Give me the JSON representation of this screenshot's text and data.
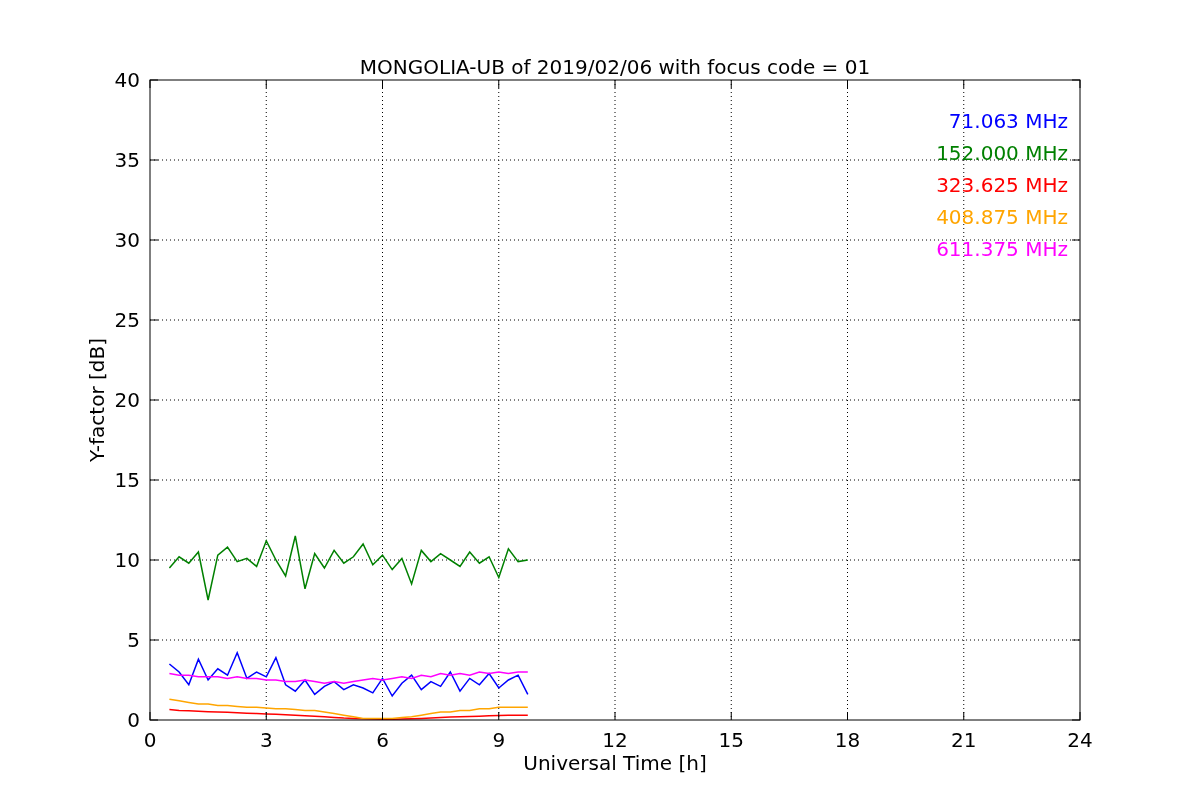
{
  "chart_data": {
    "type": "line",
    "title": "MONGOLIA-UB of 2019/02/06 with focus code = 01",
    "xlabel": "Universal Time [h]",
    "ylabel": "Y-factor [dB]",
    "x": [
      0.5,
      0.75,
      1,
      1.25,
      1.5,
      1.75,
      2,
      2.25,
      2.5,
      2.75,
      3,
      3.25,
      3.5,
      3.75,
      4,
      4.25,
      4.5,
      4.75,
      5,
      5.25,
      5.5,
      5.75,
      6,
      6.25,
      6.5,
      6.75,
      7,
      7.25,
      7.5,
      7.75,
      8,
      8.25,
      8.5,
      8.75,
      9,
      9.25,
      9.5,
      9.75
    ],
    "grid": true,
    "xlim": [
      0,
      24
    ],
    "ylim": [
      0,
      40
    ],
    "xticks": [
      0,
      3,
      6,
      9,
      12,
      15,
      18,
      21,
      24
    ],
    "yticks": [
      0,
      5,
      10,
      15,
      20,
      25,
      30,
      35,
      40
    ],
    "series": [
      {
        "name": "71.063 MHz",
        "color": "#0000ff",
        "values": [
          3.5,
          3.0,
          2.2,
          3.8,
          2.5,
          3.2,
          2.8,
          4.2,
          2.6,
          3.0,
          2.7,
          3.9,
          2.2,
          1.8,
          2.5,
          1.6,
          2.1,
          2.4,
          1.9,
          2.2,
          2.0,
          1.7,
          2.6,
          1.5,
          2.3,
          2.8,
          1.9,
          2.4,
          2.1,
          3.0,
          1.8,
          2.6,
          2.2,
          2.9,
          2.0,
          2.5,
          2.8,
          1.6
        ]
      },
      {
        "name": "152.000 MHz",
        "color": "#008000",
        "values": [
          9.5,
          10.2,
          9.8,
          10.5,
          7.5,
          10.3,
          10.8,
          9.9,
          10.1,
          9.6,
          11.2,
          10.0,
          9.0,
          11.5,
          8.2,
          10.4,
          9.5,
          10.6,
          9.8,
          10.2,
          11.0,
          9.7,
          10.3,
          9.4,
          10.1,
          8.5,
          10.6,
          9.9,
          10.4,
          10.0,
          9.6,
          10.5,
          9.8,
          10.2,
          8.9,
          10.7,
          9.9,
          10.0
        ]
      },
      {
        "name": "323.625 MHz",
        "color": "#ff0000",
        "values": [
          0.65,
          0.6,
          0.58,
          0.55,
          0.52,
          0.5,
          0.48,
          0.45,
          0.42,
          0.4,
          0.38,
          0.36,
          0.33,
          0.3,
          0.27,
          0.24,
          0.2,
          0.16,
          0.12,
          0.1,
          0.08,
          0.06,
          0.05,
          0.05,
          0.06,
          0.08,
          0.1,
          0.12,
          0.15,
          0.18,
          0.2,
          0.22,
          0.24,
          0.26,
          0.28,
          0.3,
          0.3,
          0.3
        ]
      },
      {
        "name": "408.875 MHz",
        "color": "#ffa500",
        "values": [
          1.3,
          1.2,
          1.1,
          1.0,
          1.0,
          0.9,
          0.9,
          0.85,
          0.8,
          0.8,
          0.75,
          0.7,
          0.7,
          0.65,
          0.6,
          0.6,
          0.5,
          0.4,
          0.3,
          0.2,
          0.1,
          0.1,
          0.1,
          0.1,
          0.15,
          0.2,
          0.3,
          0.4,
          0.5,
          0.5,
          0.6,
          0.6,
          0.7,
          0.7,
          0.8,
          0.8,
          0.8,
          0.8
        ]
      },
      {
        "name": "611.375 MHz",
        "color": "#ff00ff",
        "values": [
          2.9,
          2.8,
          2.8,
          2.7,
          2.7,
          2.7,
          2.6,
          2.7,
          2.6,
          2.6,
          2.5,
          2.5,
          2.4,
          2.4,
          2.5,
          2.4,
          2.3,
          2.4,
          2.3,
          2.4,
          2.5,
          2.6,
          2.5,
          2.6,
          2.7,
          2.6,
          2.8,
          2.7,
          2.9,
          2.8,
          2.9,
          2.8,
          3.0,
          2.9,
          3.0,
          2.9,
          3.0,
          3.0
        ]
      }
    ]
  }
}
